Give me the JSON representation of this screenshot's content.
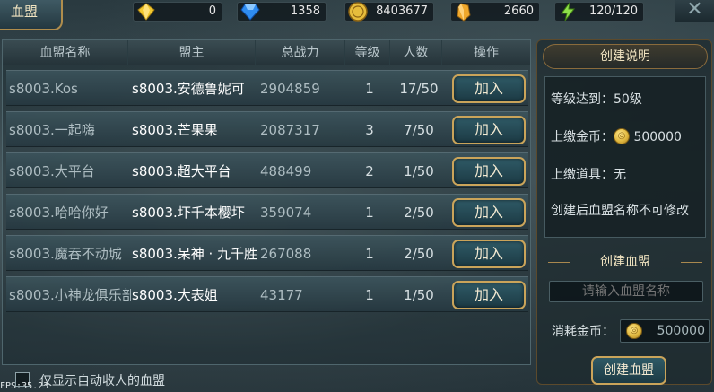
{
  "window": {
    "title": "血盟"
  },
  "resources": [
    {
      "name": "diamond-yellow",
      "value": "0"
    },
    {
      "name": "gem-blue",
      "value": "1358"
    },
    {
      "name": "gold-coin",
      "value": "8403677"
    },
    {
      "name": "crystal-orange",
      "value": "2660"
    },
    {
      "name": "energy",
      "value": "120/120"
    }
  ],
  "table": {
    "headers": [
      "血盟名称",
      "盟主",
      "总战力",
      "等级",
      "人数",
      "操作"
    ],
    "rows": [
      {
        "name": "s8003.Kos",
        "leader": "s8003.安德鲁妮可",
        "power": "2904859",
        "level": "1",
        "members": "17/50",
        "action": "加入"
      },
      {
        "name": "s8003.一起嗨",
        "leader": "s8003.芒果果",
        "power": "2087317",
        "level": "3",
        "members": "7/50",
        "action": "加入"
      },
      {
        "name": "s8003.大平台",
        "leader": "s8003.超大平台",
        "power": "488499",
        "level": "2",
        "members": "1/50",
        "action": "加入"
      },
      {
        "name": "s8003.哈哈你好",
        "leader": "s8003.圷千本樱圷",
        "power": "359074",
        "level": "1",
        "members": "2/50",
        "action": "加入"
      },
      {
        "name": "s8003.魔吞不动城",
        "leader": "s8003.呆神 · 九千胜",
        "power": "267088",
        "level": "1",
        "members": "2/50",
        "action": "加入"
      },
      {
        "name": "s8003.小神龙俱乐部",
        "leader": "s8003.大表姐",
        "power": "43177",
        "level": "1",
        "members": "1/50",
        "action": "加入"
      }
    ]
  },
  "filter": {
    "label": "仅显示自动收人的血盟",
    "checked": false
  },
  "fps": "FPS:35.23",
  "panel": {
    "title": "创建说明",
    "level_req": "等级达到：50级",
    "gold_label": "上缴金币：",
    "gold_value": "500000",
    "item_req": "上缴道具：无",
    "note": "创建后血盟名称不可修改",
    "create_title": "创建血盟",
    "name_placeholder": "请输入血盟名称",
    "cost_label": "消耗金币：",
    "cost_value": "500000",
    "create_button": "创建血盟"
  }
}
